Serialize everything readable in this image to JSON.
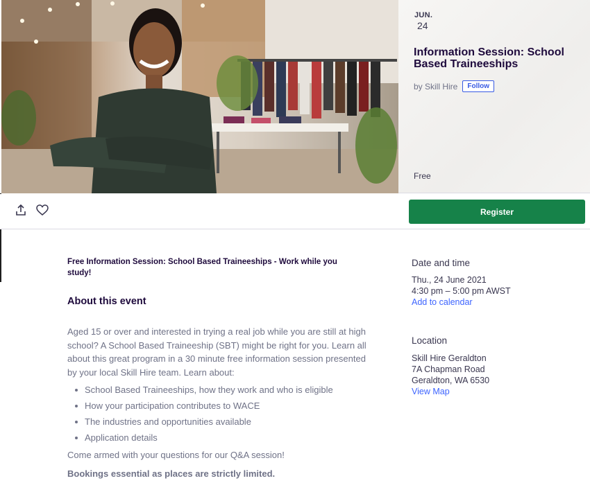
{
  "event": {
    "date_month": "JUN.",
    "date_day": "24",
    "title": "Information Session: School Based Traineeships",
    "organizer": "by Skill Hire",
    "follow_label": "Follow",
    "price": "Free"
  },
  "actions": {
    "register_label": "Register",
    "share_icon": "share-icon",
    "like_icon": "heart-icon"
  },
  "content": {
    "summary": "Free Information Session: School Based Traineeships - Work while you study!",
    "about_heading": "About this event",
    "description": "Aged 15 or over and interested in trying a real job while you are still at high school? A School Based Traineeship (SBT) might be right for you. Learn all about this great program in a 30 minute free information session presented by your local Skill Hire team. Learn about:",
    "bullets": [
      "School Based Traineeships, how they work and who is eligible",
      "How your participation contributes to WACE",
      "The industries and opportunities available",
      "Application details"
    ],
    "qa_line": "Come armed with your questions for our Q&A session!",
    "bookings": "Bookings essential as places are strictly limited."
  },
  "sidebar": {
    "date_heading": "Date and time",
    "date_line": "Thu., 24 June 2021",
    "time_line": "4:30 pm – 5:00 pm AWST",
    "add_calendar": "Add to calendar",
    "location_heading": "Location",
    "venue": "Skill Hire Geraldton",
    "street": "7A Chapman Road",
    "city": "Geraldton, WA 6530",
    "view_map": "View Map"
  },
  "colors": {
    "register": "#168249",
    "link": "#3d64ff",
    "follow": "#3659e3",
    "title": "#1e0a3c",
    "body_text": "#6f7287"
  }
}
